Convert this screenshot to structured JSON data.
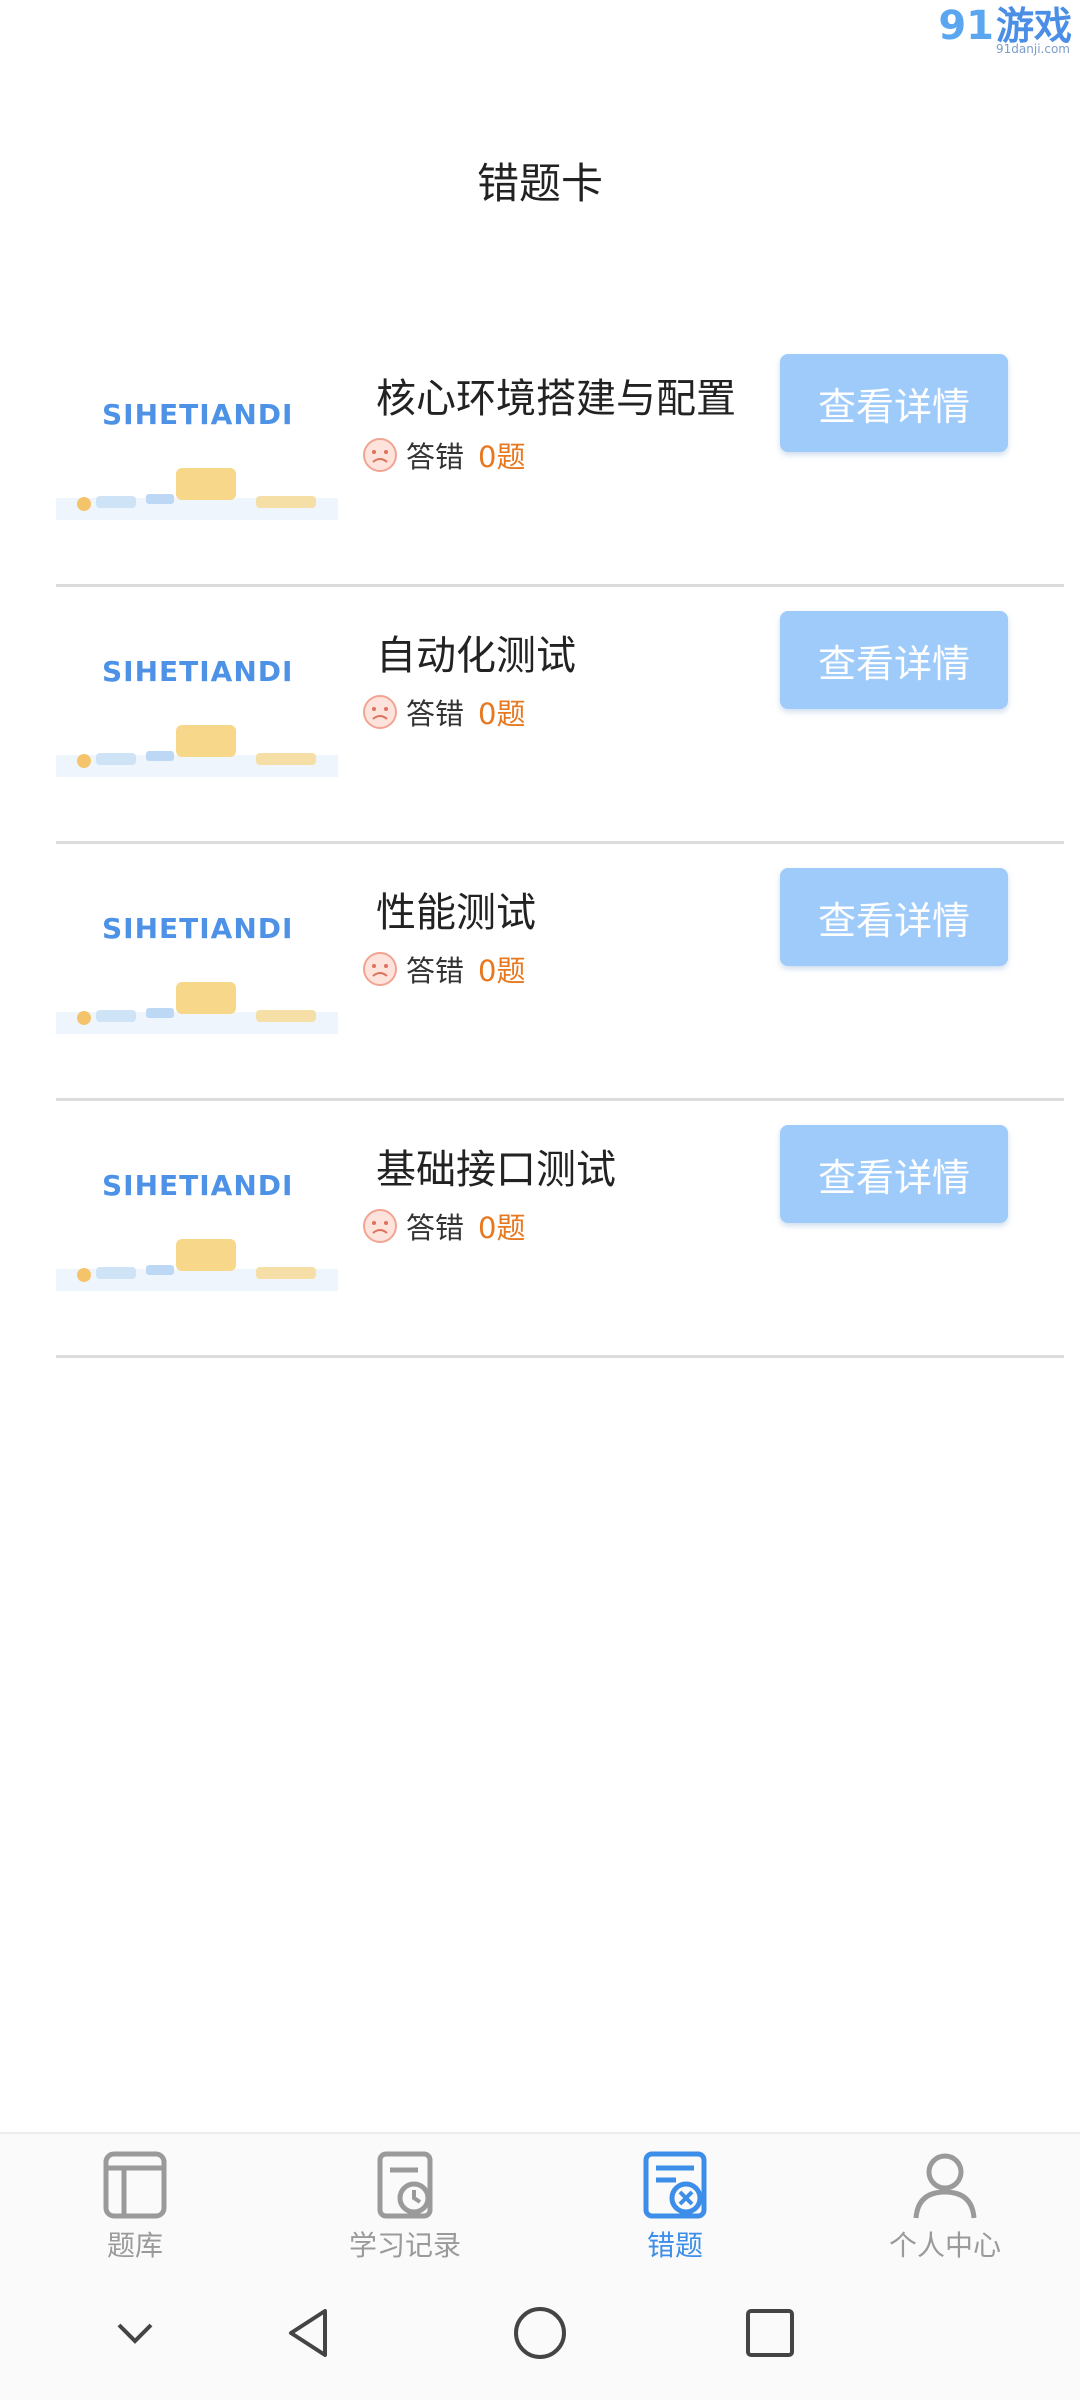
{
  "watermark": {
    "logo": "91",
    "text": "游戏",
    "url": "91danji.com"
  },
  "header": {
    "title": "错题卡"
  },
  "cards": [
    {
      "thumb_brand": "SIHETIANDI",
      "title": "核心环境搭建与配置",
      "wrong_label": "答错",
      "wrong_count": "0题",
      "button": "查看详情"
    },
    {
      "thumb_brand": "SIHETIANDI",
      "title": "自动化测试",
      "wrong_label": "答错",
      "wrong_count": "0题",
      "button": "查看详情"
    },
    {
      "thumb_brand": "SIHETIANDI",
      "title": "性能测试",
      "wrong_label": "答错",
      "wrong_count": "0题",
      "button": "查看详情"
    },
    {
      "thumb_brand": "SIHETIANDI",
      "title": "基础接口测试",
      "wrong_label": "答错",
      "wrong_count": "0题",
      "button": "查看详情"
    }
  ],
  "tabbar": {
    "tabs": [
      {
        "label": "题库",
        "icon": "question-bank-icon",
        "active": false
      },
      {
        "label": "学习记录",
        "icon": "study-history-icon",
        "active": false
      },
      {
        "label": "错题",
        "icon": "wrong-questions-icon",
        "active": true
      },
      {
        "label": "个人中心",
        "icon": "profile-icon",
        "active": false
      }
    ]
  },
  "colors": {
    "accent": "#3d8ee8",
    "button": "#9fcbfa",
    "count": "#e8781f",
    "inactive": "#9a9a9a"
  }
}
